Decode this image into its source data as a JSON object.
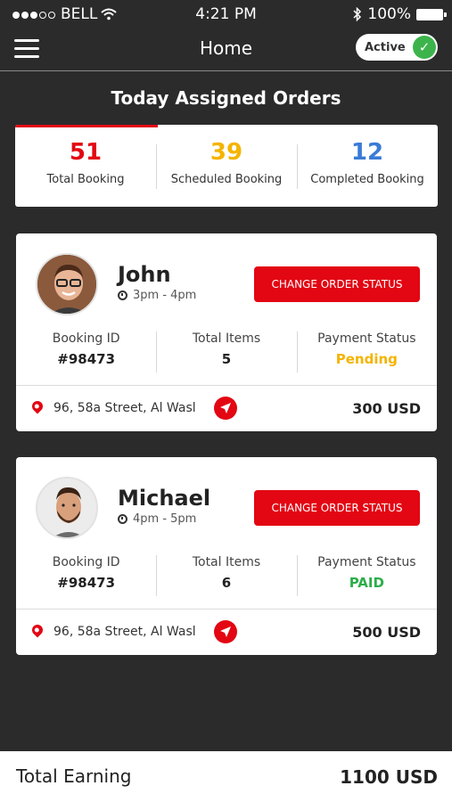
{
  "status_bar": {
    "carrier": "BELL",
    "time": "4:21 PM",
    "battery": "100%"
  },
  "nav": {
    "title": "Home",
    "toggle_label": "Active"
  },
  "section_title": "Today Assigned Orders",
  "stats": [
    {
      "value": "51",
      "label": "Total Booking",
      "color": "#e30613"
    },
    {
      "value": "39",
      "label": "Scheduled Booking",
      "color": "#f4b400"
    },
    {
      "value": "12",
      "label": "Completed Booking",
      "color": "#3a7bd5"
    }
  ],
  "orders": [
    {
      "name": "John",
      "time": "3pm - 4pm",
      "button_label": "CHANGE ORDER STATUS",
      "booking_id_label": "Booking ID",
      "booking_id": "#98473",
      "items_label": "Total Items",
      "items": "5",
      "payment_label": "Payment Status",
      "payment_status": "Pending",
      "address": "96, 58a Street, Al Wasl",
      "amount": "300 USD"
    },
    {
      "name": "Michael",
      "time": "4pm - 5pm",
      "button_label": "CHANGE ORDER STATUS",
      "booking_id_label": "Booking ID",
      "booking_id": "#98473",
      "items_label": "Total Items",
      "items": "6",
      "payment_label": "Payment Status",
      "payment_status": "PAID",
      "address": "96, 58a Street, Al Wasl",
      "amount": "500 USD"
    }
  ],
  "footer": {
    "label": "Total Earning",
    "total": "1100 USD"
  }
}
